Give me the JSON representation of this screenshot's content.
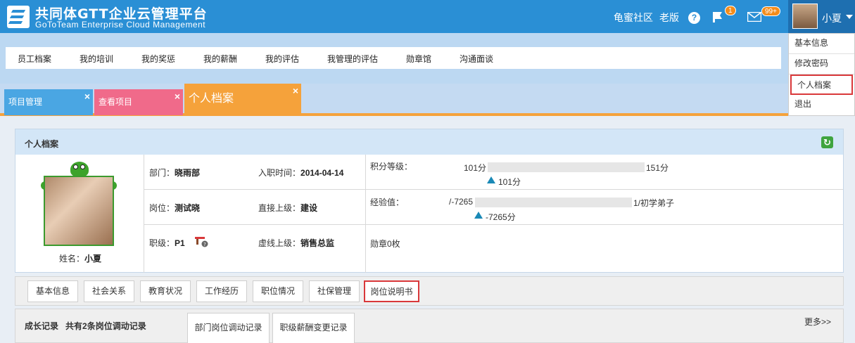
{
  "header": {
    "title": "共同体GTT企业云管理平台",
    "subtitle": "GoToTeam Enterprise Cloud Management",
    "links": [
      "龟蜜社区",
      "老版"
    ],
    "help_symbol": "?",
    "flag_badge": "1",
    "mail_badge": "99+",
    "user_name": "小夏"
  },
  "dropdown": {
    "items": [
      "基本信息",
      "修改密码",
      "个人档案",
      "退出"
    ]
  },
  "menu": {
    "items": [
      "员工档案",
      "我的培训",
      "我的奖惩",
      "我的薪酬",
      "我的评估",
      "我管理的评估",
      "勋章馆",
      "沟通面谈"
    ]
  },
  "tabs": [
    {
      "label": "项目管理",
      "close": "×",
      "color": "#4aa6e3"
    },
    {
      "label": "查看项目",
      "close": "×",
      "color": "#f06a8a"
    },
    {
      "label": "个人档案",
      "close": "×",
      "color": "#f5a23b"
    }
  ],
  "panel": {
    "title": "个人档案",
    "refresh_symbol": "↻",
    "name_label": "姓名：",
    "name_value": "小夏",
    "dept_label": "部门：",
    "dept_value": "晓雨部",
    "join_label": "入职时间：",
    "join_value": "2014-04-14",
    "position_label": "岗位：",
    "position_value": "测试晓",
    "superior_label": "直接上级：",
    "superior_value": "建设",
    "level_label": "职级：",
    "level_value": "P1",
    "dotted_label": "虚线上级：",
    "dotted_value": "销售总监",
    "score": {
      "label": "积分等级：",
      "min": "101分",
      "max": "151分",
      "current": "101分",
      "fill": 0
    },
    "exp": {
      "label": "经验值：",
      "min": "/-7265",
      "max": "1/初学弟子",
      "current": "-7265分",
      "fill": 0
    },
    "medals": "勋章0枚"
  },
  "subtabs": [
    "基本信息",
    "社会关系",
    "教育状况",
    "工作经历",
    "职位情况",
    "社保管理",
    "岗位说明书"
  ],
  "growth": {
    "title": "成长记录",
    "summary_pre": "共有",
    "summary_count": "2",
    "summary_post": "条岗位调动记录",
    "tabs": [
      "部门岗位调动记录",
      "职级薪酬变更记录"
    ],
    "more": "更多>>"
  },
  "colors": {
    "header_bg": "#2a8fd5",
    "accent_orange": "#f5a23b",
    "highlight_red": "#d9383a"
  }
}
